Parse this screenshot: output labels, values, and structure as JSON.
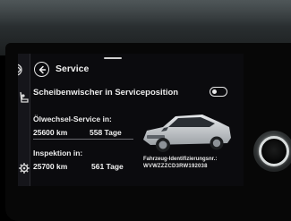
{
  "screen": {
    "title": "Service",
    "back_icon": "back-arrow-icon",
    "wiper": {
      "label": "Scheibenwischer in Serviceposition",
      "toggle_state": "off"
    },
    "oil": {
      "label": "Ölwechsel-Service in:",
      "distance": "25600 km",
      "days": "558 Tage"
    },
    "inspection": {
      "label": "Inspektion in:",
      "distance": "25700 km",
      "days": "561 Tage"
    },
    "vehicle": {
      "id_label": "Fahrzeug-Identifizierungsnr.:",
      "vin": "WVWZZZCD3RW192038",
      "image": "car-icon"
    },
    "side_icons": [
      "partial-icon",
      "seat-icon",
      "gear-icon"
    ]
  },
  "colors": {
    "screen_bg": "#0b0b0e",
    "text": "#ececec",
    "car_body": "#c9ccd0"
  }
}
